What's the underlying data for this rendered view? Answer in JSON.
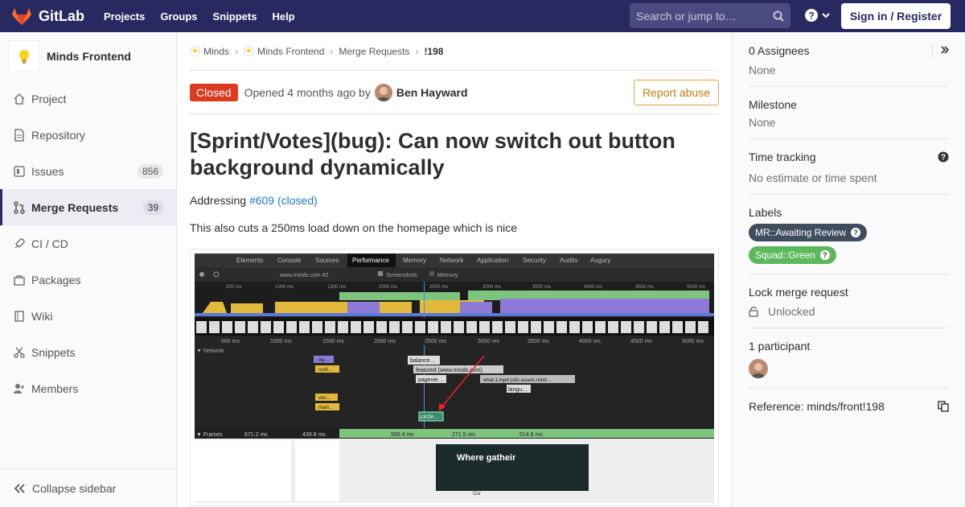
{
  "navbar": {
    "brand": "GitLab",
    "links": [
      "Projects",
      "Groups",
      "Snippets",
      "Help"
    ],
    "search_placeholder": "Search or jump to…",
    "signin_label": "Sign in / Register"
  },
  "sidebar": {
    "project_name": "Minds Frontend",
    "items": [
      {
        "label": "Project",
        "icon": "home-icon"
      },
      {
        "label": "Repository",
        "icon": "doc-icon"
      },
      {
        "label": "Issues",
        "icon": "issues-icon",
        "count": "856"
      },
      {
        "label": "Merge Requests",
        "icon": "merge-icon",
        "count": "39",
        "active": true
      },
      {
        "label": "CI / CD",
        "icon": "rocket-icon"
      },
      {
        "label": "Packages",
        "icon": "package-icon"
      },
      {
        "label": "Wiki",
        "icon": "book-icon"
      },
      {
        "label": "Snippets",
        "icon": "scissors-icon"
      },
      {
        "label": "Members",
        "icon": "users-icon"
      }
    ],
    "collapse_label": "Collapse sidebar"
  },
  "breadcrumb": {
    "items": [
      "Minds",
      "Minds Frontend",
      "Merge Requests",
      "!198"
    ]
  },
  "mr": {
    "status": "Closed",
    "opened_text": "Opened 4 months ago by",
    "author": "Ben Hayward",
    "report_label": "Report abuse",
    "title": "[Sprint/Votes](bug): Can now switch out button background dynamically",
    "addressing": "Addressing",
    "issue_link": "#609 (closed)",
    "desc2": "This also cuts a 250ms load down on the homepage which is nice"
  },
  "devtools": {
    "tabs": [
      "Elements",
      "Console",
      "Sources",
      "Performance",
      "Memory",
      "Network",
      "Application",
      "Security",
      "Audits",
      "Augury"
    ],
    "url": "www.minds.com #2",
    "screenshots": "Screenshots",
    "memory": "Memory",
    "ticks": [
      "500 ms",
      "1000 ms",
      "1500 ms",
      "2000 ms",
      "2500 ms",
      "3000 ms",
      "3500 ms",
      "4000 ms",
      "4500 ms",
      "5000 ms"
    ],
    "network_label": "▼ Network",
    "frames_label": "▼ Frames",
    "frames": [
      "671.2 ms",
      "439.8 ms",
      "569.4 ms",
      "271.5 ms",
      "514.8 ms"
    ],
    "requests": [
      "balance…",
      "featured (www.minds.com)",
      "pagevie…",
      "what-1.mp4 (cdn-assets.mind…",
      "langu…",
      "circle…",
      "sty…",
      "runti…",
      "von…",
      "main…"
    ],
    "frame_text": "Where gatheir",
    "frame_sub": "Our"
  },
  "right": {
    "assignees_title": "0 Assignees",
    "assignees_val": "None",
    "milestone_title": "Milestone",
    "milestone_val": "None",
    "time_title": "Time tracking",
    "time_val": "No estimate or time spent",
    "labels_title": "Labels",
    "labels": [
      {
        "text": "MR::Awaiting Review",
        "color": "#3f4d5e"
      },
      {
        "text": "Squad::Green",
        "color": "#5cb85c"
      }
    ],
    "lock_title": "Lock merge request",
    "lock_val": "Unlocked",
    "participants_title": "1 participant",
    "reference": "Reference: minds/front!198"
  },
  "colors": {
    "navbar": "#292961",
    "closed": "#db3b21",
    "link": "#1f78d1",
    "report": "#e2a241"
  }
}
